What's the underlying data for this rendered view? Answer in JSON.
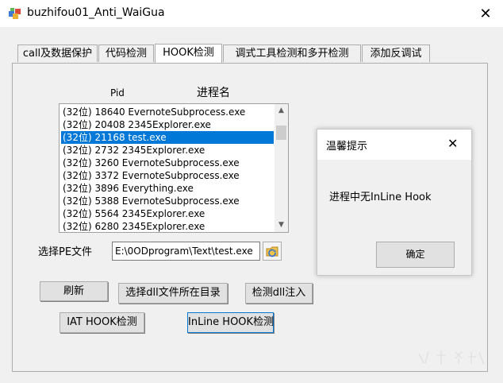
{
  "window": {
    "title": "buzhifou01_Anti_WaiGua",
    "close_glyph": "✕"
  },
  "tabs": [
    {
      "label": "call及数据保护",
      "active": false
    },
    {
      "label": "代码检测",
      "active": false
    },
    {
      "label": "HOOK检测",
      "active": true
    },
    {
      "label": "调式工具检测和多开检测",
      "active": false
    },
    {
      "label": "添加反调试",
      "active": false
    }
  ],
  "process_panel": {
    "pid_header": "Pid",
    "name_header": "进程名",
    "items": [
      "(32位) 18640 EvernoteSubprocess.exe",
      "(32位) 20408 2345Explorer.exe",
      "(32位) 21168 test.exe",
      "(32位) 2732 2345Explorer.exe",
      "(32位) 3260 EvernoteSubprocess.exe",
      "(32位) 3372 EvernoteSubprocess.exe",
      "(32位) 3896 Everything.exe",
      "(32位) 5388 EvernoteSubprocess.exe",
      "(32位) 5564 2345Explorer.exe",
      "(32位) 6280 2345Explorer.exe"
    ],
    "selected_index": 2
  },
  "pe_file": {
    "label": "选择PE文件",
    "value": "E:\\0ODprogram\\Text\\test.exe"
  },
  "buttons": {
    "refresh": "刷新",
    "choose_dll_dir": "选择dll文件所在目录",
    "detect_dll_inject": "检测dll注入",
    "iat_hook": "IAT HOOK检测",
    "inline_hook": "InLine HOOK检测"
  },
  "dialog": {
    "title": "温馨提示",
    "close_glyph": "✕",
    "message": "进程中无InLine Hook",
    "ok_label": "确定"
  },
  "colors": {
    "selection": "#0078d7",
    "window_bg": "#f0f0f0",
    "button_face": "#e1e1e1"
  }
}
